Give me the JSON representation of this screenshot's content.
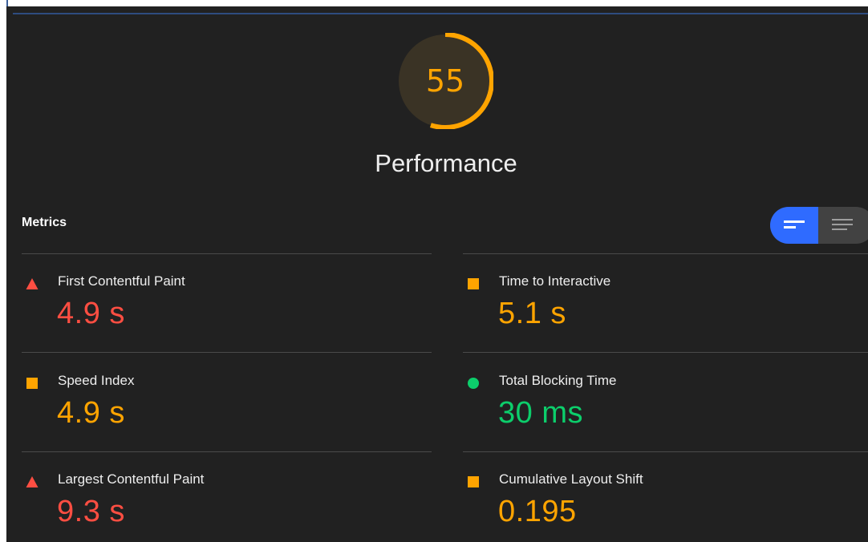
{
  "gauge": {
    "score": "55",
    "score_fraction": 0.55,
    "color": "#ffa400",
    "track_color": "#3a3325"
  },
  "category": {
    "title": "Performance"
  },
  "metrics_section": {
    "heading": "Metrics",
    "toggle": {
      "active_option": "list-view",
      "options": [
        "compact-view-icon",
        "list-view-icon"
      ]
    },
    "items": [
      {
        "label": "First Contentful Paint",
        "value": "4.9 s",
        "rating": "fail",
        "marker_icon": "red-triangle-icon",
        "color": "#ff4e42"
      },
      {
        "label": "Time to Interactive",
        "value": "5.1 s",
        "rating": "average",
        "marker_icon": "orange-square-icon",
        "color": "#ffa400"
      },
      {
        "label": "Speed Index",
        "value": "4.9 s",
        "rating": "average",
        "marker_icon": "orange-square-icon",
        "color": "#ffa400"
      },
      {
        "label": "Total Blocking Time",
        "value": "30 ms",
        "rating": "pass",
        "marker_icon": "green-circle-icon",
        "color": "#0cce6b"
      },
      {
        "label": "Largest Contentful Paint",
        "value": "9.3 s",
        "rating": "fail",
        "marker_icon": "red-triangle-icon",
        "color": "#ff4e42"
      },
      {
        "label": "Cumulative Layout Shift",
        "value": "0.195",
        "rating": "average",
        "marker_icon": "orange-square-icon",
        "color": "#ffa400"
      }
    ]
  }
}
